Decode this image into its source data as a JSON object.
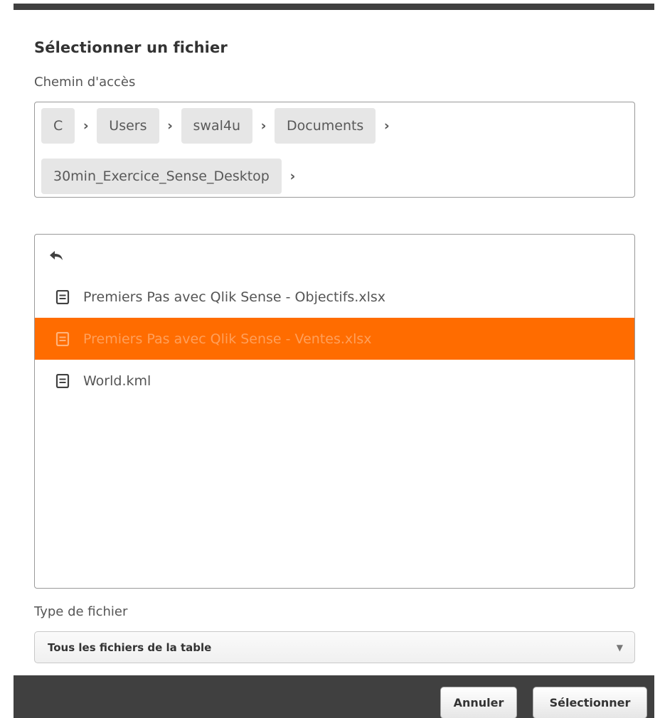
{
  "dialog": {
    "title": "Sélectionner un fichier",
    "path_label": "Chemin d'accès",
    "breadcrumb": [
      "C",
      "Users",
      "swal4u",
      "Documents",
      "30min_Exercice_Sense_Desktop"
    ],
    "breadcrumb_separator": "›",
    "back_icon": "back-arrow-icon",
    "files": [
      {
        "name": "Premiers Pas avec Qlik Sense - Objectifs.xlsx",
        "icon": "file-icon",
        "selected": false
      },
      {
        "name": "Premiers Pas avec Qlik Sense - Ventes.xlsx",
        "icon": "file-icon",
        "selected": true
      },
      {
        "name": "World.kml",
        "icon": "file-icon",
        "selected": false
      }
    ],
    "file_type_label": "Type de fichier",
    "file_type_value": "Tous les fichiers de la table",
    "cancel_label": "Annuler",
    "select_label": "Sélectionner"
  },
  "colors": {
    "accent": "#ff6c00",
    "header_bar": "#404040"
  }
}
